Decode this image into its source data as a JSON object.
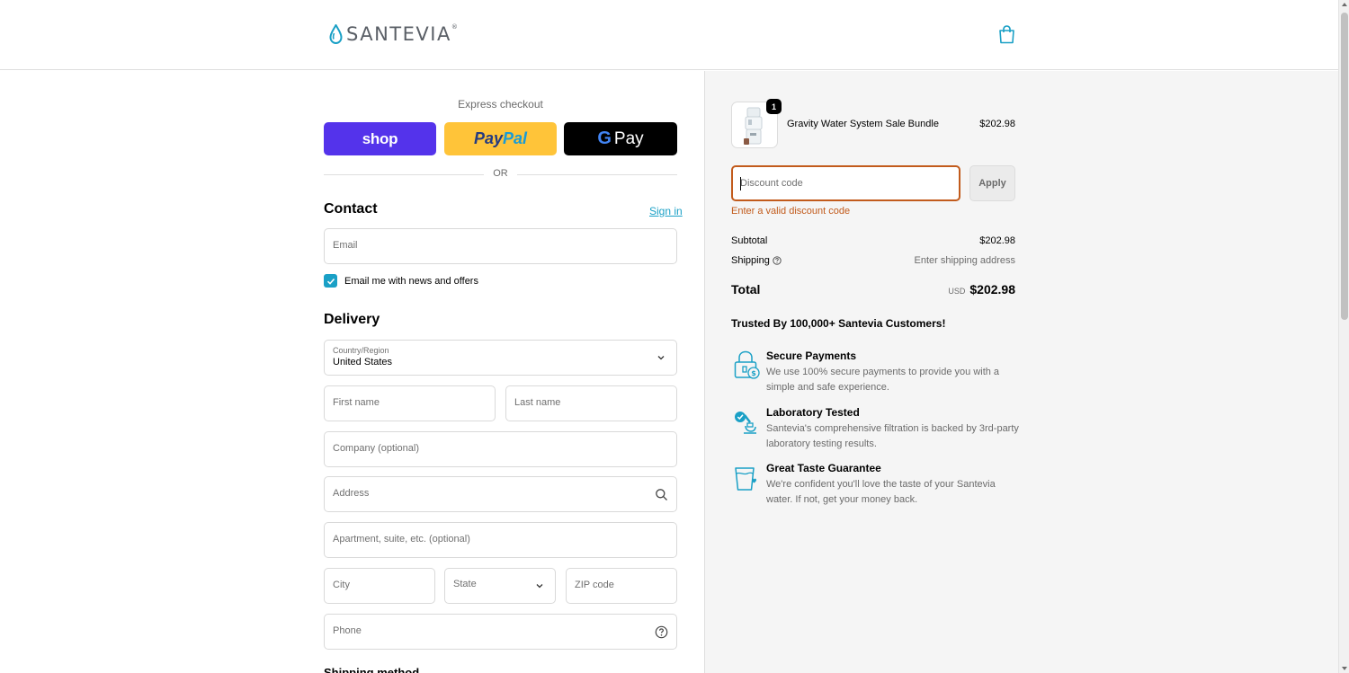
{
  "header": {
    "brand": "SANTEVIA",
    "brand_mark": "®",
    "cart_icon": "shopping-bag-icon"
  },
  "express": {
    "title": "Express checkout",
    "shop_label": "shop",
    "paypal_label_1": "Pay",
    "paypal_label_2": "Pal",
    "gpay_g": "G",
    "gpay_label": "Pay",
    "or_label": "OR"
  },
  "contact": {
    "title": "Contact",
    "signin_label": "Sign in",
    "email_placeholder": "Email",
    "newsletter_label": "Email me with news and offers",
    "newsletter_checked": true
  },
  "delivery": {
    "title": "Delivery",
    "country_label": "Country/Region",
    "country_value": "United States",
    "first_name_placeholder": "First name",
    "last_name_placeholder": "Last name",
    "company_placeholder": "Company (optional)",
    "address_placeholder": "Address",
    "apartment_placeholder": "Apartment, suite, etc. (optional)",
    "city_placeholder": "City",
    "state_placeholder": "State",
    "zip_placeholder": "ZIP code",
    "phone_placeholder": "Phone"
  },
  "shipping_method": {
    "title": "Shipping method"
  },
  "summary": {
    "product": {
      "name": "Gravity Water System Sale Bundle",
      "quantity": "1",
      "price": "$202.98"
    },
    "discount": {
      "placeholder": "Discount code",
      "apply_label": "Apply",
      "error": "Enter a valid discount code"
    },
    "subtotal_label": "Subtotal",
    "subtotal_value": "$202.98",
    "shipping_label": "Shipping",
    "shipping_value": "Enter shipping address",
    "total_label": "Total",
    "total_currency": "USD",
    "total_value": "$202.98"
  },
  "trust": {
    "heading": "Trusted By 100,000+ Santevia Customers!",
    "items": [
      {
        "title": "Secure Payments",
        "desc": "We use 100% secure payments to provide you with a simple and safe experience.",
        "icon": "secure-lock-icon"
      },
      {
        "title": "Laboratory Tested",
        "desc": "Santevia's comprehensive filtration is backed by 3rd-party laboratory testing results.",
        "icon": "microscope-icon"
      },
      {
        "title": "Great Taste Guarantee",
        "desc": "We're confident you'll love the taste of your Santevia water. If not, get your money back.",
        "icon": "water-glass-icon"
      }
    ]
  },
  "colors": {
    "accent": "#1aa0c6",
    "shop_purple": "#5433eb",
    "paypal_yellow": "#ffc439",
    "error": "#c25b1c"
  }
}
